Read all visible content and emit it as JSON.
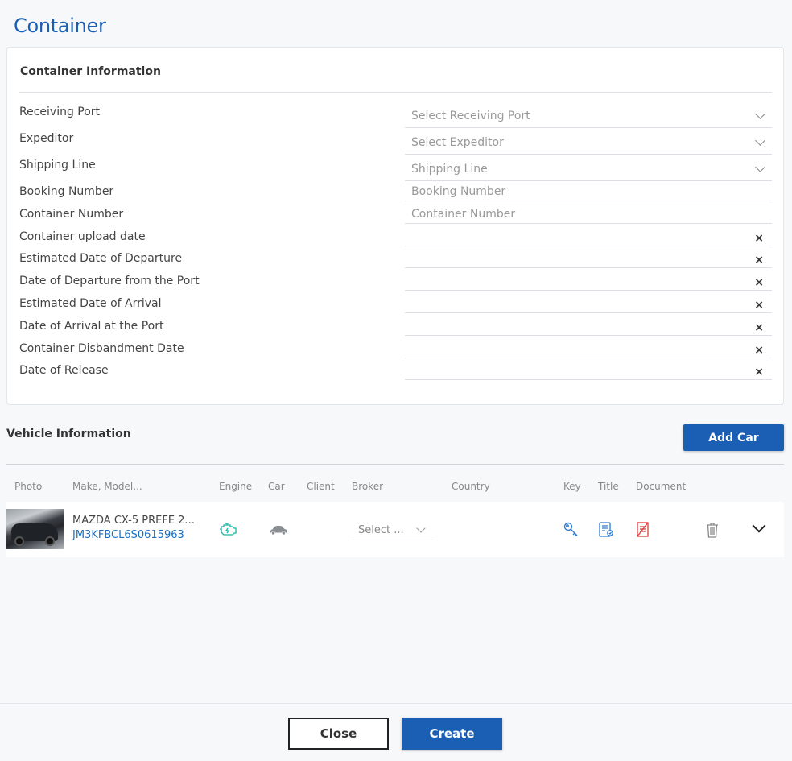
{
  "page": {
    "title": "Container"
  },
  "container_info": {
    "title": "Container Information",
    "fields": [
      {
        "label": "Receiving Port",
        "placeholder": "Select Receiving Port",
        "type": "select"
      },
      {
        "label": "Expeditor",
        "placeholder": "Select Expeditor",
        "type": "select"
      },
      {
        "label": "Shipping Line",
        "placeholder": "Shipping Line",
        "type": "select"
      },
      {
        "label": "Booking Number",
        "placeholder": "Booking Number",
        "type": "text"
      },
      {
        "label": "Container Number",
        "placeholder": "Container Number",
        "type": "text"
      },
      {
        "label": "Container upload date",
        "clear": "×",
        "type": "date"
      },
      {
        "label": "Estimated Date of Departure",
        "clear": "×",
        "type": "date"
      },
      {
        "label": "Date of Departure from the Port",
        "clear": "×",
        "type": "date"
      },
      {
        "label": "Estimated Date of Arrival",
        "clear": "×",
        "type": "date"
      },
      {
        "label": "Date of Arrival at the Port",
        "clear": "×",
        "type": "date"
      },
      {
        "label": "Container Disbandment Date",
        "clear": "×",
        "type": "date"
      },
      {
        "label": "Date of Release",
        "clear": "×",
        "type": "date"
      }
    ]
  },
  "vehicle_info": {
    "title": "Vehicle Information",
    "add_car_label": "Add Car",
    "columns": {
      "photo": "Photo",
      "make_model": "Make, Model...",
      "engine": "Engine",
      "car": "Car",
      "client": "Client",
      "broker": "Broker",
      "country": "Country",
      "key": "Key",
      "title": "Title",
      "document": "Document"
    },
    "row": {
      "model": "MAZDA CX-5 PREFE 2...",
      "vin": "JM3KFBCL6S0615963",
      "broker_placeholder": "Select ..."
    }
  },
  "footer": {
    "close_label": "Close",
    "create_label": "Create"
  },
  "colors": {
    "accent": "#1a5fb4",
    "engine_icon": "#1bb5a5",
    "document_icon": "#e03a3a"
  }
}
